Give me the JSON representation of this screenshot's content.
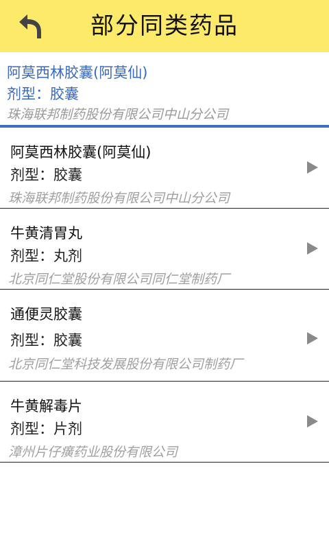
{
  "header": {
    "title": "部分同类药品",
    "back_icon": "back-arrow-icon",
    "background": "#fde96a"
  },
  "current": {
    "name": "阿莫西林胶囊(阿莫仙)",
    "form": "剂型：胶囊",
    "maker": "珠海联邦制药股份有限公司中山分公司",
    "color": "#3a69c0"
  },
  "items": [
    {
      "name": "阿莫西林胶囊(阿莫仙)",
      "form": "剂型：胶囊",
      "maker": "珠海联邦制药股份有限公司中山分公司"
    },
    {
      "name": "牛黄清胃丸",
      "form": "剂型：丸剂",
      "maker": "北京同仁堂股份有限公司同仁堂制药厂"
    },
    {
      "name": "通便灵胶囊",
      "form": "剂型：胶囊",
      "maker": "北京同仁堂科技发展股份有限公司制药厂"
    },
    {
      "name": "牛黄解毒片",
      "form": "剂型：片剂",
      "maker": "漳州片仔癀药业股份有限公司"
    }
  ],
  "icons": {
    "row_arrow": "chevron-right-triangle-icon"
  }
}
